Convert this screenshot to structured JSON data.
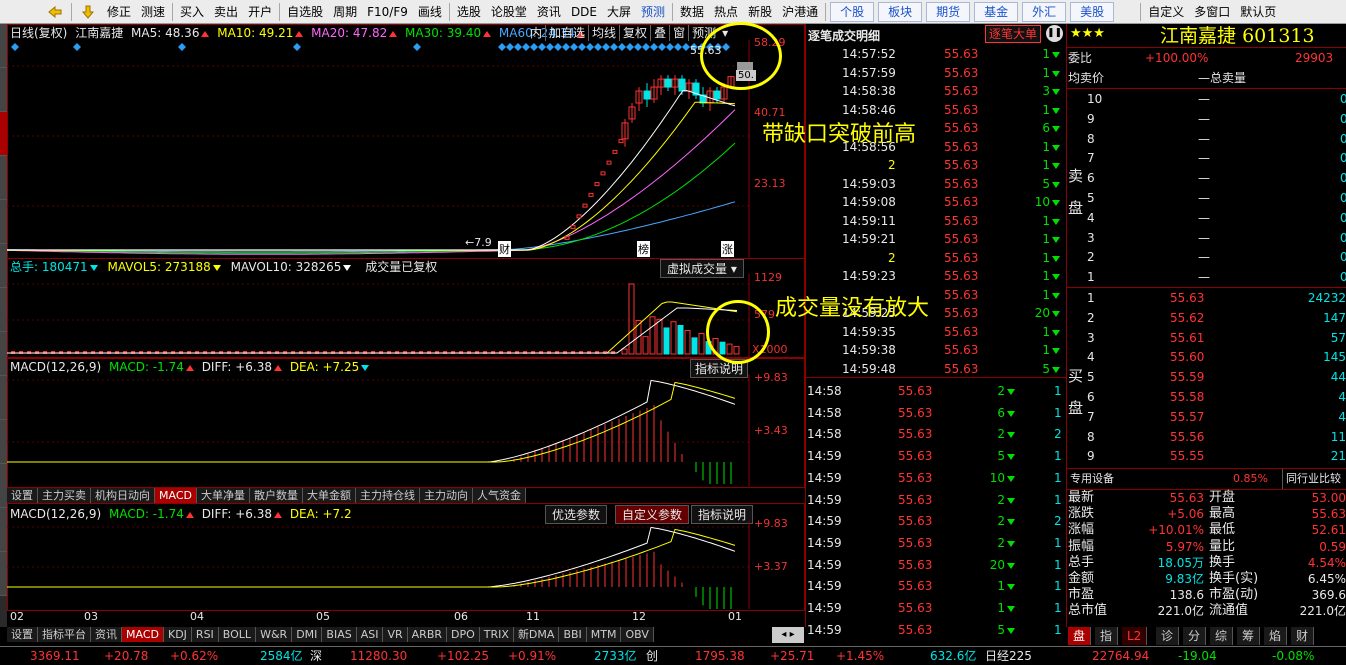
{
  "toolbar": {
    "items": [
      "修正",
      "测速",
      "买入",
      "卖出",
      "开户",
      "自选股",
      "周期",
      "F10/F9",
      "画线",
      "选股",
      "论股堂",
      "资讯",
      "DDE",
      "大屏",
      "预测",
      "数据",
      "热点",
      "新股",
      "沪港通"
    ],
    "quick": [
      "个股",
      "板块",
      "期货",
      "基金",
      "外汇",
      "美股"
    ],
    "right": [
      "自定义",
      "多窗口",
      "默认页"
    ]
  },
  "kline": {
    "mode": "日线(复权)",
    "name": "江南嘉捷",
    "ma5": "MA5: 48.36",
    "ma10": "MA10: 49.21",
    "ma20": "MA20: 47.82",
    "ma30": "MA30: 39.40",
    "ma60": "MA60: 24.34",
    "top_btns": [
      "内",
      "加自选",
      "均线",
      "复权",
      "叠",
      "窗",
      "预测"
    ],
    "y_labels": [
      "58.29",
      "40.71",
      "23.13"
    ],
    "marks": [
      "财",
      "榜",
      "涨"
    ],
    "low_mark": "7.9",
    "top_mark": "55.63",
    "mini_val": "50."
  },
  "volume": {
    "total": "总手: 180471",
    "mavol5": "MAVOL5: 273188",
    "mavol10": "MAVOL10: 328265",
    "note": "成交量已复权",
    "virtual": "虚拟成交量",
    "y_labels": [
      "1129",
      "579",
      "X1000"
    ]
  },
  "macd1": {
    "label": "MACD(12,26,9)",
    "macd": "MACD: -1.74",
    "diff": "DIFF: +6.38",
    "dea": "DEA: +7.25",
    "btn": "指标说明",
    "y_labels": [
      "+9.83",
      "+3.43"
    ]
  },
  "indicator_tabs": [
    "设置",
    "主力买卖",
    "机构日动向",
    "MACD",
    "大单净量",
    "散户数量",
    "大单金额",
    "主力持仓线",
    "主力动向",
    "人气资金"
  ],
  "macd2": {
    "label": "MACD(12,26,9)",
    "macd": "MACD: -1.74",
    "diff": "DIFF: +6.38",
    "dea": "DEA: +7.2",
    "btns": [
      "优选参数",
      "自定义参数",
      "指标说明"
    ],
    "y_labels": [
      "+9.83",
      "+3.37"
    ]
  },
  "x_axis": [
    "02",
    "03",
    "04",
    "05",
    "06",
    "11",
    "12",
    "01"
  ],
  "bottom_tabs": [
    "设置",
    "指标平台",
    "资讯",
    "MACD",
    "KDJ",
    "RSI",
    "BOLL",
    "W&R",
    "DMI",
    "BIAS",
    "ASI",
    "VR",
    "ARBR",
    "DPO",
    "TRIX",
    "新DMA",
    "BBI",
    "MTM",
    "OBV"
  ],
  "ticks": {
    "title": "逐笔成交明细",
    "btn": "逐笔大单",
    "rows": [
      [
        "14:57:52",
        "55.63",
        "1"
      ],
      [
        "14:57:59",
        "55.63",
        "1"
      ],
      [
        "14:58:38",
        "55.63",
        "3"
      ],
      [
        "14:58:46",
        "55.63",
        "1"
      ],
      [
        "",
        "55.63",
        "6"
      ],
      [
        "14:58:56",
        "55.63",
        "1"
      ],
      [
        "2",
        "55.63",
        "1"
      ],
      [
        "14:59:03",
        "55.63",
        "5"
      ],
      [
        "14:59:08",
        "55.63",
        "10"
      ],
      [
        "14:59:11",
        "55.63",
        "1"
      ],
      [
        "14:59:21",
        "55.63",
        "1"
      ],
      [
        "2",
        "55.63",
        "1"
      ],
      [
        "14:59:23",
        "55.63",
        "1"
      ],
      [
        "",
        "55.63",
        "1"
      ],
      [
        "14:59:25",
        "55.63",
        "20"
      ],
      [
        "14:59:35",
        "55.63",
        "1"
      ],
      [
        "14:59:38",
        "55.63",
        "1"
      ],
      [
        "14:59:48",
        "55.63",
        "5"
      ]
    ]
  },
  "minute_ticks": [
    [
      "14:58",
      "55.63",
      "2",
      "1"
    ],
    [
      "14:58",
      "55.63",
      "6",
      "1"
    ],
    [
      "14:58",
      "55.63",
      "2",
      "2"
    ],
    [
      "14:59",
      "55.63",
      "5",
      "1"
    ],
    [
      "14:59",
      "55.63",
      "10",
      "1"
    ],
    [
      "14:59",
      "55.63",
      "2",
      "1"
    ],
    [
      "14:59",
      "55.63",
      "2",
      "2"
    ],
    [
      "14:59",
      "55.63",
      "2",
      "1"
    ],
    [
      "14:59",
      "55.63",
      "20",
      "1"
    ],
    [
      "14:59",
      "55.63",
      "1",
      "1"
    ],
    [
      "14:59",
      "55.63",
      "1",
      "1"
    ],
    [
      "14:59",
      "55.63",
      "5",
      "1"
    ]
  ],
  "quote": {
    "stars": "★★★",
    "name": "江南嘉捷",
    "code": "601313",
    "weibi_label": "委比",
    "weibi": "+100.00%",
    "weicha": "29903",
    "avg_label": "均卖价",
    "total_label": "总卖量",
    "sell_label": [
      "卖",
      "盘"
    ],
    "buy_label": [
      "买",
      "盘"
    ],
    "sells": [
      [
        "10",
        "—",
        "0"
      ],
      [
        "9",
        "—",
        "0"
      ],
      [
        "8",
        "—",
        "0"
      ],
      [
        "7",
        "—",
        "0"
      ],
      [
        "6",
        "—",
        "0"
      ],
      [
        "5",
        "—",
        "0"
      ],
      [
        "4",
        "—",
        "0"
      ],
      [
        "3",
        "—",
        "0"
      ],
      [
        "2",
        "—",
        "0"
      ],
      [
        "1",
        "—",
        "0"
      ]
    ],
    "buys": [
      [
        "1",
        "55.63",
        "24232"
      ],
      [
        "2",
        "55.62",
        "147"
      ],
      [
        "3",
        "55.61",
        "57"
      ],
      [
        "4",
        "55.60",
        "145"
      ],
      [
        "5",
        "55.59",
        "44"
      ],
      [
        "6",
        "55.58",
        "4"
      ],
      [
        "7",
        "55.57",
        "4"
      ],
      [
        "8",
        "55.56",
        "11"
      ],
      [
        "9",
        "55.55",
        "21"
      ]
    ],
    "sector_label": "专用设备",
    "sector_pct": "0.85%",
    "compare": "同行业比较",
    "stats": [
      [
        "最新",
        "55.63",
        "开盘",
        "53.00"
      ],
      [
        "涨跌",
        "+5.06",
        "最高",
        "55.63"
      ],
      [
        "涨幅",
        "+10.01%",
        "最低",
        "52.61"
      ],
      [
        "振幅",
        "5.97%",
        "量比",
        "0.59"
      ],
      [
        "总手",
        "18.05万",
        "换手",
        "4.54%"
      ],
      [
        "金额",
        "9.83亿",
        "换手(实)",
        "6.45%"
      ],
      [
        "市盈",
        "138.6",
        "市盈(动)",
        "369.6"
      ],
      [
        "总市值",
        "221.0亿",
        "流通值",
        "221.0亿"
      ]
    ],
    "tabs": [
      "盘",
      "指",
      "L2",
      "诊",
      "分",
      "综",
      "筹",
      "焰",
      "财"
    ]
  },
  "status": {
    "sh": "3369.11",
    "sh_chg": "+20.78",
    "sh_pct": "+0.62%",
    "sh_amt": "2584亿",
    "sz_label": "深",
    "sz": "11280.30",
    "sz_chg": "+102.25",
    "sz_pct": "+0.91%",
    "sz_amt": "2733亿",
    "cy_label": "创",
    "cy": "1795.38",
    "cy_chg": "+25.71",
    "cy_pct": "+1.45%",
    "cy_amt": "632.6亿",
    "nk_label": "日经225",
    "nk": "22764.94",
    "nk_chg": "-19.04",
    "nk_pct": "-0.08%"
  },
  "annotations": [
    "带缺口突破前高",
    "成交量没有放大"
  ],
  "colors": {
    "up": "#ff3333",
    "down": "#00e5e5",
    "ma5": "#ffffff",
    "ma10": "#ffff00",
    "ma20": "#ff66ff",
    "ma30": "#00e000",
    "ma60": "#4aa6ff"
  }
}
